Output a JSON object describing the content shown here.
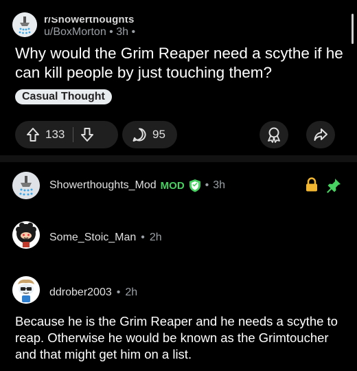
{
  "post": {
    "subreddit": "r/Showerthoughts",
    "author": "u/BoxMorton",
    "age": "3h",
    "title": "Why would the Grim Reaper need a scythe if he can kill people by just touching them?",
    "flair": "Casual Thought"
  },
  "actions": {
    "upvotes": "133",
    "comments": "95",
    "icons": [
      "upvote-icon",
      "downvote-icon",
      "comment-icon",
      "award-icon",
      "share-icon"
    ]
  },
  "comments": [
    {
      "username": "Showerthoughts_Mod",
      "badge": "MOD",
      "age": "3h",
      "icons": [
        "shield-icon",
        "lock-icon",
        "pin-icon"
      ]
    },
    {
      "username": "Some_Stoic_Man",
      "age": "2h"
    },
    {
      "username": "ddrober2003",
      "age": "2h",
      "body": "Because he is the Grim Reaper and he needs a scythe to reap. Otherwise he would be known as the Grimtoucher and that might get him on a list."
    }
  ],
  "separator": "•",
  "colors": {
    "background": "#000000",
    "mod_green": "#46d160",
    "lock": "#f2b630",
    "pin": "#46d160",
    "flair_bg": "#e9ecef"
  }
}
